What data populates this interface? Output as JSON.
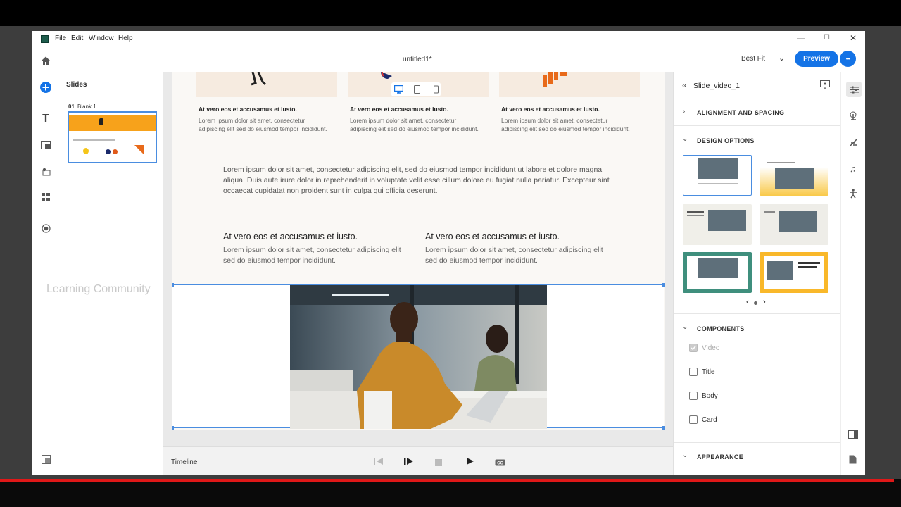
{
  "menu": {
    "file": "File",
    "edit": "Edit",
    "window": "Window",
    "help": "Help"
  },
  "window_controls": {
    "minimize": "—",
    "maximize": "☐",
    "close": "✕"
  },
  "document_title": "untitled1*",
  "header": {
    "fit_label": "Best Fit",
    "preview_label": "Preview",
    "more": "•••"
  },
  "slides_panel": {
    "title": "Slides",
    "slide_number": "01",
    "slide_name": "Blank 1"
  },
  "watermark": "Learning Community",
  "slide": {
    "cards": [
      {
        "title": "At vero eos et accusamus et iusto.",
        "body": "Lorem ipsum dolor sit amet, consectetur adipiscing elit sed do eiusmod tempor incididunt."
      },
      {
        "title": "At vero eos et accusamus et iusto.",
        "body": "Lorem ipsum dolor sit amet, consectetur adipiscing elit sed do eiusmod tempor incididunt."
      },
      {
        "title": "At vero eos et accusamus et iusto.",
        "body": "Lorem ipsum dolor sit amet, consectetur adipiscing elit sed do eiusmod tempor incididunt."
      }
    ],
    "paragraph": "Lorem ipsum dolor sit amet, consectetur adipiscing elit, sed do eiusmod tempor incididunt ut labore et dolore magna aliqua. Duis aute irure dolor in reprehenderit in voluptate velit esse cillum dolore eu fugiat nulla pariatur. Excepteur sint occaecat cupidatat non proident sunt in culpa qui officia deserunt.",
    "columns": [
      {
        "title": "At vero eos et accusamus et iusto.",
        "body": "Lorem ipsum dolor sit amet, consectetur adipiscing elit sed do eiusmod tempor incididunt."
      },
      {
        "title": "At vero eos et accusamus et iusto.",
        "body": "Lorem ipsum dolor sit amet, consectetur adipiscing elit sed do eiusmod tempor incididunt."
      }
    ]
  },
  "timeline": {
    "label": "Timeline"
  },
  "right_panel": {
    "component_name": "Slide_video_1",
    "sections": {
      "alignment": "ALIGNMENT AND SPACING",
      "design": "DESIGN OPTIONS",
      "components": "COMPONENTS",
      "appearance": "APPEARANCE"
    },
    "components": [
      {
        "label": "Video",
        "checked": true,
        "disabled": true
      },
      {
        "label": "Title",
        "checked": false,
        "disabled": false
      },
      {
        "label": "Body",
        "checked": false,
        "disabled": false
      },
      {
        "label": "Card",
        "checked": false,
        "disabled": false
      }
    ]
  },
  "colors": {
    "accent": "#1473e6",
    "orange": "#f7a21b",
    "selection": "#4a8de0"
  }
}
